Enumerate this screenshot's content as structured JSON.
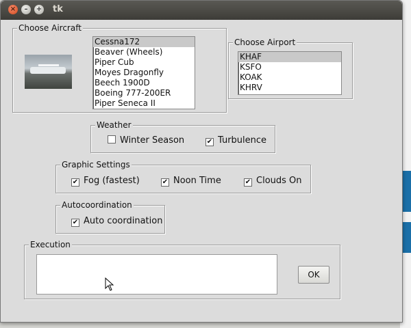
{
  "window": {
    "title": "tk"
  },
  "aircraft": {
    "group_label": "Choose Aircraft",
    "items": [
      "Cessna172",
      "Beaver (Wheels)",
      "Piper Cub",
      "Moyes Dragonfly",
      "Beech 1900D",
      "Boeing 777-200ER",
      "Piper Seneca II"
    ],
    "selected_index": 0
  },
  "airport": {
    "group_label": "Choose Airport",
    "items": [
      "KHAF",
      "KSFO",
      "KOAK",
      "KHRV"
    ],
    "selected_index": 0
  },
  "weather": {
    "group_label": "Weather",
    "winter": {
      "label": "Winter Season",
      "checked": false
    },
    "turbulence": {
      "label": "Turbulence",
      "checked": true
    }
  },
  "graphics": {
    "group_label": "Graphic Settings",
    "fog": {
      "label": "Fog (fastest)",
      "checked": true
    },
    "noon": {
      "label": "Noon Time",
      "checked": true
    },
    "clouds": {
      "label": "Clouds On",
      "checked": true
    }
  },
  "autocoord": {
    "group_label": "Autocoordination",
    "auto": {
      "label": "Auto coordination",
      "checked": true
    }
  },
  "execution": {
    "group_label": "Execution",
    "value": "",
    "ok_label": "OK"
  },
  "icons": {
    "check_glyph": "✔",
    "close_glyph": "×",
    "min_glyph": "–",
    "max_glyph": "+"
  }
}
